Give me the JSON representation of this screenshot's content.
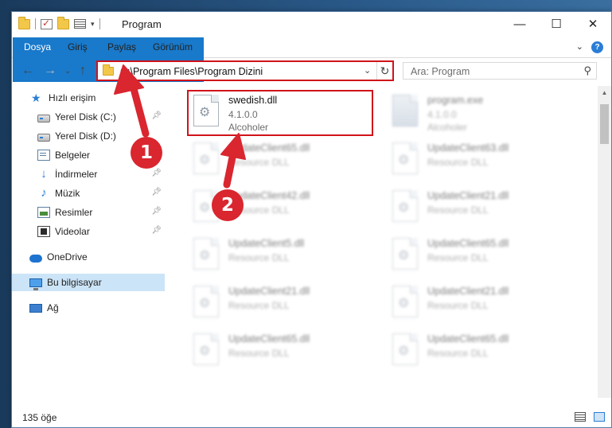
{
  "window": {
    "title": "Program"
  },
  "ribbon": {
    "tabs": [
      "Dosya",
      "Giriş",
      "Paylaş",
      "Görünüm"
    ]
  },
  "address": {
    "path": "C:\\Program Files\\Program Dizini"
  },
  "search": {
    "placeholder": "Ara: Program"
  },
  "sidebar": {
    "items": [
      {
        "label": "Hızlı erişim",
        "icon": "star-icon"
      },
      {
        "label": "Yerel Disk (C:)",
        "icon": "drive-icon",
        "pinned": true
      },
      {
        "label": "Yerel Disk (D:)",
        "icon": "drive-icon",
        "pinned": false
      },
      {
        "label": "Belgeler",
        "icon": "documents-icon",
        "pinned": true
      },
      {
        "label": "İndirmeler",
        "icon": "downloads-icon",
        "pinned": true
      },
      {
        "label": "Müzik",
        "icon": "music-icon",
        "pinned": true
      },
      {
        "label": "Resimler",
        "icon": "pictures-icon",
        "pinned": true
      },
      {
        "label": "Videolar",
        "icon": "videos-icon",
        "pinned": true
      },
      {
        "label": "OneDrive",
        "icon": "cloud-icon"
      },
      {
        "label": "Bu bilgisayar",
        "icon": "computer-icon",
        "selected": true
      },
      {
        "label": "Ağ",
        "icon": "network-icon"
      }
    ]
  },
  "files": [
    {
      "name": "swedish.dll",
      "line2": "4.1.0.0",
      "line3": "Alcoholer",
      "highlighted": true
    },
    {
      "name": "program.exe",
      "line2": "4.1.0.0",
      "line3": "Alcoholer"
    },
    {
      "name": "UpdateClient65.dll",
      "line2": "Resource DLL"
    },
    {
      "name": "UpdateClient63.dll",
      "line2": "Resource DLL"
    },
    {
      "name": "UpdateClient42.dll",
      "line2": "Resource DLL"
    },
    {
      "name": "UpdateClient21.dll",
      "line2": "Resource DLL"
    },
    {
      "name": "UpdateClient5.dll",
      "line2": "Resource DLL"
    },
    {
      "name": "UpdateClient65.dll",
      "line2": "Resource DLL"
    },
    {
      "name": "UpdateClient21.dll",
      "line2": "Resource DLL"
    },
    {
      "name": "UpdateClient21.dll",
      "line2": "Resource DLL"
    },
    {
      "name": "UpdateClient65.dll",
      "line2": "Resource DLL"
    },
    {
      "name": "UpdateClient65.dll",
      "line2": "Resource DLL"
    }
  ],
  "status": {
    "count": "135 öğe"
  },
  "annotations": {
    "badge1": "1",
    "badge2": "2",
    "color": "#d9262f"
  }
}
